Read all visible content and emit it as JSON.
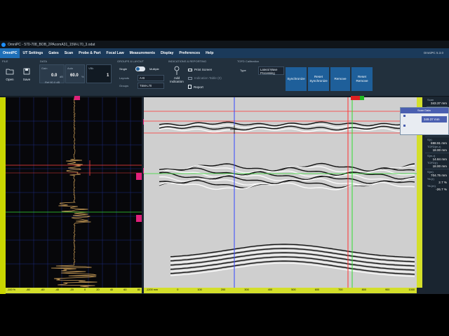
{
  "window": {
    "title": "OmniPC - 570-708_BOB_2PAcomA31_15M-L70_3.odat",
    "version": "OmniPC 5.3.0"
  },
  "menu": [
    "OmniPC",
    "UT Settings",
    "Gates",
    "Scan",
    "Probe & Part",
    "Focal Law",
    "Measurements",
    "Display",
    "Preferences",
    "Help"
  ],
  "ribbon": {
    "file": {
      "title": "FILE",
      "open": "Open",
      "save": "Save"
    },
    "data": {
      "title": "DATA",
      "gain_label": "Gain",
      "gain_value": "0.0",
      "gain_unit": "dB",
      "ref_label": "Ref 80.0 dB",
      "auto_label": "Auto",
      "auto_value": "60.0",
      "auto_unit": "%",
      "vel_label": "VBk",
      "vel_value": "1"
    },
    "groups": {
      "title": "GROUPS & LAYOUT",
      "single": "Single",
      "multiple": "Multiple",
      "layouts_label": "Layouts",
      "layouts_value": "A-B",
      "groups_label": "Groups",
      "groups_value": "TSM-L70"
    },
    "indications": {
      "title": "INDICATIONS & REPORTING",
      "add": "Add Indication",
      "print": "Print Screen",
      "table": "Indication Table (0)",
      "report": "Report"
    },
    "tofd": {
      "title": "TOFD Calibration",
      "type_label": "Type",
      "type_value": "Lateral Wave Processing",
      "sync": "Synchronize",
      "reset_sync": "Reset Synchronize",
      "remove": "Remove",
      "reset_remove": "Reset Remove"
    }
  },
  "popup": {
    "title": "Scan Data",
    "value": "349.37 mm"
  },
  "readouts": [
    {
      "label": "Scan",
      "value": "343.37 mm"
    },
    {
      "label": "Custom",
      "value": ""
    },
    {
      "label": "TOFD(m-r)",
      "value": "18.00 mm"
    },
    {
      "label": "%(r)",
      "value": "2.7 %"
    },
    {
      "label": "%L(m-r)",
      "value": "-26.7 %"
    },
    {
      "label": "S(r)",
      "value": "698.91 mm"
    },
    {
      "label": "TOFD(m-r)",
      "value": "18.00 mm"
    },
    {
      "label": "S(m-r)",
      "value": "14.84 mm"
    },
    {
      "label": "TOFD(r)",
      "value": "18.00 mm"
    },
    {
      "label": "S(m)",
      "value": "704.75 mm"
    },
    {
      "label": "%L(r)",
      "value": "2.7 %"
    },
    {
      "label": "%L(m)",
      "value": "-26.7 %"
    }
  ],
  "ascan_axis": [
    "-100 %",
    "-80",
    "-60",
    "-40",
    "-20",
    "0",
    "20",
    "40",
    "60",
    "80"
  ],
  "bscan_axis": [
    "-1200 mm",
    "0",
    "100",
    "200",
    "300",
    "400",
    "500",
    "600",
    "700",
    "800",
    "900",
    "1000"
  ],
  "colors": {
    "menubar": "#1b3a5a",
    "accent": "#1e6fb8",
    "cursor_red": "#ff3030",
    "cursor_green": "#33dd33",
    "cursor_blue": "#3344ff",
    "axis": "#d4df2a"
  }
}
